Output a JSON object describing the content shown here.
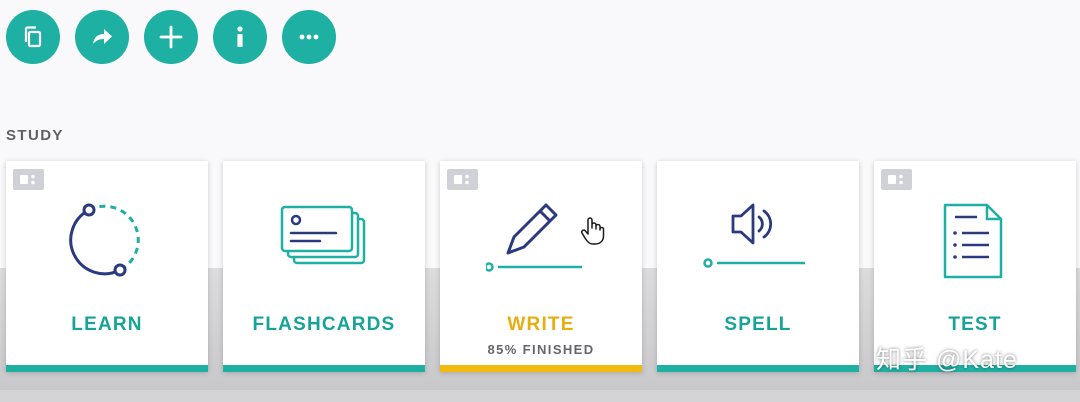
{
  "toolbar": {
    "buttons": [
      {
        "icon": "copy-icon"
      },
      {
        "icon": "share-icon"
      },
      {
        "icon": "plus-icon"
      },
      {
        "icon": "info-icon"
      },
      {
        "icon": "more-icon"
      }
    ]
  },
  "study": {
    "title": "STUDY",
    "cards": [
      {
        "label": "LEARN",
        "icon": "learn-progress-icon"
      },
      {
        "label": "FLASHCARDS",
        "icon": "flashcards-icon"
      },
      {
        "label": "WRITE",
        "icon": "pencil-icon",
        "status": "85% FINISHED"
      },
      {
        "label": "SPELL",
        "icon": "speaker-icon"
      },
      {
        "label": "TEST",
        "icon": "test-document-icon"
      }
    ]
  },
  "watermark": "知乎 @Kate",
  "colors": {
    "accent": "#1fb0a4",
    "active": "#f2b90f",
    "icon_navy": "#2b3a80"
  }
}
